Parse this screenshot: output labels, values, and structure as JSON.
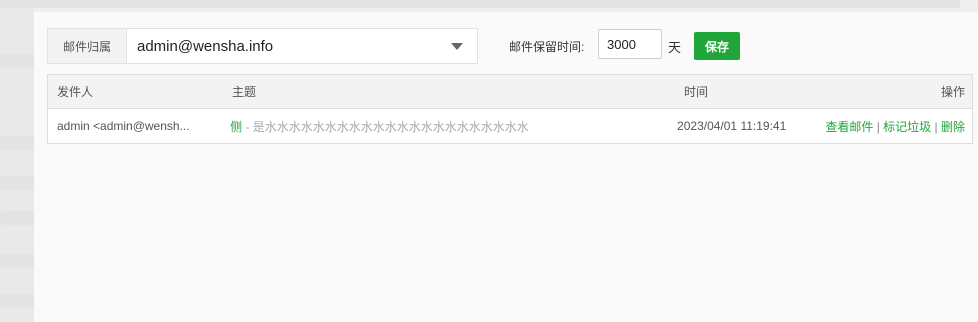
{
  "filter": {
    "owner_label": "邮件归属",
    "owner_value": "admin@wensha.info",
    "retention_label": "邮件保留时间:",
    "retention_value": "3000",
    "retention_unit": "天",
    "save_label": "保存"
  },
  "table": {
    "headers": {
      "sender": "发件人",
      "subject": "主题",
      "time": "时间",
      "ops": "操作"
    },
    "rows": [
      {
        "sender": "admin <admin@wensh...",
        "subject_prefix": "侧",
        "subject_rest": " - 是水水水水水水水水水水水水水水水水水水水水水水",
        "time": "2023/04/01 11:19:41",
        "op_view": "查看邮件",
        "op_spam": "标记垃圾",
        "op_delete": "删除",
        "separator": "|"
      }
    ]
  },
  "colors": {
    "accent": "#20a53a"
  }
}
